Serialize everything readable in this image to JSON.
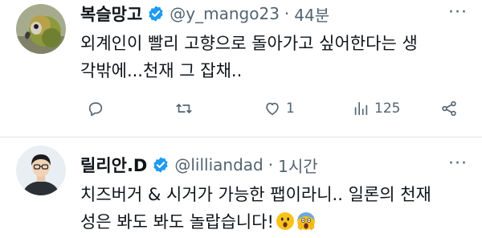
{
  "tweets": [
    {
      "display_name": "복슬망고",
      "handle": "@y_mango23",
      "separator": "·",
      "time": "44분",
      "text_lines": [
        "외계인이 빨리 고향으로 돌아가고 싶어한다는 생",
        "각밖에...천재 그 잡채.."
      ],
      "reply_count": "",
      "retweet_count": "",
      "like_count": "1",
      "view_count": "125",
      "more": "···"
    },
    {
      "display_name": "릴리안.D",
      "handle": "@lilliandad",
      "separator": "·",
      "time": "1시간",
      "text_lines": [
        "치즈버거 & 시거가 가능한 팹이라니.. 일론의 천재",
        "성은 봐도 봐도 놀랍습니다!"
      ],
      "emojis": [
        "hushed-face-emoji",
        "screaming-face-emoji"
      ],
      "more": "···"
    }
  ],
  "colors": {
    "verified_badge": "#1d9bf0",
    "secondary_text": "#536471",
    "primary_text": "#0f1419",
    "divider": "#dfe3e6"
  },
  "icons": [
    "reply-icon",
    "retweet-icon",
    "like-icon",
    "views-icon",
    "share-icon",
    "verified-badge-icon"
  ]
}
